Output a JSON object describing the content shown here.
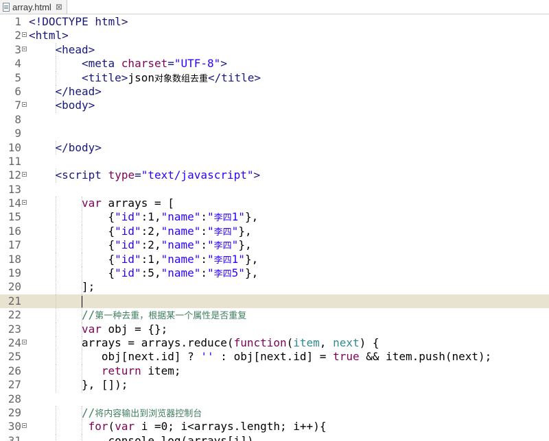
{
  "tab": {
    "title": "array.html",
    "close_glyph": "⊠"
  },
  "editor": {
    "current_line": 21,
    "lines": [
      {
        "n": "1",
        "fold": false,
        "indent": 0,
        "segs": [
          {
            "c": "tg",
            "t": "<!DOCTYPE html>"
          }
        ]
      },
      {
        "n": "2",
        "fold": true,
        "indent": 0,
        "segs": [
          {
            "c": "tg",
            "t": "<html>"
          }
        ]
      },
      {
        "n": "3",
        "fold": true,
        "indent": 1,
        "segs": [
          {
            "c": "tg",
            "t": "<head>"
          }
        ]
      },
      {
        "n": "4",
        "fold": false,
        "indent": 2,
        "segs": [
          {
            "c": "tg",
            "t": "<meta "
          },
          {
            "c": "at",
            "t": "charset"
          },
          {
            "c": "tg",
            "t": "="
          },
          {
            "c": "st",
            "t": "\"UTF-8\""
          },
          {
            "c": "tg",
            "t": ">"
          }
        ]
      },
      {
        "n": "5",
        "fold": false,
        "indent": 2,
        "segs": [
          {
            "c": "tg",
            "t": "<title>"
          },
          {
            "c": "nm",
            "t": "json"
          },
          {
            "c": "nm cjk",
            "t": "对象数组去重"
          },
          {
            "c": "tg",
            "t": "</title>"
          }
        ]
      },
      {
        "n": "6",
        "fold": false,
        "indent": 1,
        "segs": [
          {
            "c": "tg",
            "t": "</head>"
          }
        ]
      },
      {
        "n": "7",
        "fold": true,
        "indent": 1,
        "segs": [
          {
            "c": "tg",
            "t": "<body>"
          }
        ]
      },
      {
        "n": "8",
        "fold": false,
        "indent": 0,
        "segs": []
      },
      {
        "n": "9",
        "fold": false,
        "indent": 0,
        "segs": []
      },
      {
        "n": "10",
        "fold": false,
        "indent": 1,
        "segs": [
          {
            "c": "tg",
            "t": "</body>"
          }
        ]
      },
      {
        "n": "11",
        "fold": false,
        "indent": 0,
        "segs": []
      },
      {
        "n": "12",
        "fold": true,
        "indent": 1,
        "segs": [
          {
            "c": "tg",
            "t": "<script "
          },
          {
            "c": "at",
            "t": "type"
          },
          {
            "c": "tg",
            "t": "="
          },
          {
            "c": "st",
            "t": "\"text/javascript\""
          },
          {
            "c": "tg",
            "t": ">"
          }
        ]
      },
      {
        "n": "13",
        "fold": false,
        "indent": 0,
        "segs": []
      },
      {
        "n": "14",
        "fold": true,
        "indent": 2,
        "segs": [
          {
            "c": "kw",
            "t": "var "
          },
          {
            "c": "js",
            "t": "arrays = ["
          }
        ]
      },
      {
        "n": "15",
        "fold": false,
        "indent": 3,
        "segs": [
          {
            "c": "js",
            "t": "{"
          },
          {
            "c": "jsstr",
            "t": "\"id\""
          },
          {
            "c": "js",
            "t": ":1,"
          },
          {
            "c": "jsstr",
            "t": "\"name\""
          },
          {
            "c": "js",
            "t": ":"
          },
          {
            "c": "jsstr",
            "t": "\""
          },
          {
            "c": "jsstr cjk",
            "t": "李四"
          },
          {
            "c": "jsstr",
            "t": "1\""
          },
          {
            "c": "js",
            "t": "},"
          }
        ]
      },
      {
        "n": "16",
        "fold": false,
        "indent": 3,
        "segs": [
          {
            "c": "js",
            "t": "{"
          },
          {
            "c": "jsstr",
            "t": "\"id\""
          },
          {
            "c": "js",
            "t": ":2,"
          },
          {
            "c": "jsstr",
            "t": "\"name\""
          },
          {
            "c": "js",
            "t": ":"
          },
          {
            "c": "jsstr",
            "t": "\""
          },
          {
            "c": "jsstr cjk",
            "t": "李四"
          },
          {
            "c": "jsstr",
            "t": "\""
          },
          {
            "c": "js",
            "t": "},"
          }
        ]
      },
      {
        "n": "17",
        "fold": false,
        "indent": 3,
        "segs": [
          {
            "c": "js",
            "t": "{"
          },
          {
            "c": "jsstr",
            "t": "\"id\""
          },
          {
            "c": "js",
            "t": ":2,"
          },
          {
            "c": "jsstr",
            "t": "\"name\""
          },
          {
            "c": "js",
            "t": ":"
          },
          {
            "c": "jsstr",
            "t": "\""
          },
          {
            "c": "jsstr cjk",
            "t": "李四"
          },
          {
            "c": "jsstr",
            "t": "\""
          },
          {
            "c": "js",
            "t": "},"
          }
        ]
      },
      {
        "n": "18",
        "fold": false,
        "indent": 3,
        "segs": [
          {
            "c": "js",
            "t": "{"
          },
          {
            "c": "jsstr",
            "t": "\"id\""
          },
          {
            "c": "js",
            "t": ":1,"
          },
          {
            "c": "jsstr",
            "t": "\"name\""
          },
          {
            "c": "js",
            "t": ":"
          },
          {
            "c": "jsstr",
            "t": "\""
          },
          {
            "c": "jsstr cjk",
            "t": "李四"
          },
          {
            "c": "jsstr",
            "t": "1\""
          },
          {
            "c": "js",
            "t": "},"
          }
        ]
      },
      {
        "n": "19",
        "fold": false,
        "indent": 3,
        "segs": [
          {
            "c": "js",
            "t": "{"
          },
          {
            "c": "jsstr",
            "t": "\"id\""
          },
          {
            "c": "js",
            "t": ":5,"
          },
          {
            "c": "jsstr",
            "t": "\"name\""
          },
          {
            "c": "js",
            "t": ":"
          },
          {
            "c": "jsstr",
            "t": "\""
          },
          {
            "c": "jsstr cjk",
            "t": "李四"
          },
          {
            "c": "jsstr",
            "t": "5\""
          },
          {
            "c": "js",
            "t": "},"
          }
        ]
      },
      {
        "n": "20",
        "fold": false,
        "indent": 2,
        "segs": [
          {
            "c": "js",
            "t": "];"
          }
        ]
      },
      {
        "n": "21",
        "fold": false,
        "indent": 2,
        "segs": []
      },
      {
        "n": "22",
        "fold": false,
        "indent": 2,
        "segs": [
          {
            "c": "cm",
            "t": "//"
          },
          {
            "c": "cm cjk",
            "t": "第一种去重，根据某一个属性是否重复"
          }
        ]
      },
      {
        "n": "23",
        "fold": false,
        "indent": 2,
        "segs": [
          {
            "c": "kw",
            "t": "var "
          },
          {
            "c": "js",
            "t": "obj = {};"
          }
        ]
      },
      {
        "n": "24",
        "fold": true,
        "indent": 2,
        "segs": [
          {
            "c": "js",
            "t": "arrays = arrays.reduce("
          },
          {
            "c": "kw",
            "t": "function"
          },
          {
            "c": "js",
            "t": "("
          },
          {
            "c": "prop",
            "t": "item"
          },
          {
            "c": "js",
            "t": ", "
          },
          {
            "c": "prop",
            "t": "next"
          },
          {
            "c": "js",
            "t": ") {"
          }
        ]
      },
      {
        "n": "25",
        "fold": false,
        "indent": 2,
        "pad": "   ",
        "segs": [
          {
            "c": "js",
            "t": "obj[next.id] ? "
          },
          {
            "c": "jsstr",
            "t": "''"
          },
          {
            "c": "js",
            "t": " : obj[next.id] = "
          },
          {
            "c": "bool",
            "t": "true"
          },
          {
            "c": "js",
            "t": " && item.push(next);"
          }
        ]
      },
      {
        "n": "26",
        "fold": false,
        "indent": 2,
        "pad": "   ",
        "segs": [
          {
            "c": "kw",
            "t": "return "
          },
          {
            "c": "js",
            "t": "item;"
          }
        ]
      },
      {
        "n": "27",
        "fold": false,
        "indent": 2,
        "segs": [
          {
            "c": "js",
            "t": "}, []);"
          }
        ]
      },
      {
        "n": "28",
        "fold": false,
        "indent": 0,
        "segs": []
      },
      {
        "n": "29",
        "fold": false,
        "indent": 2,
        "segs": [
          {
            "c": "cm",
            "t": "//"
          },
          {
            "c": "cm cjk",
            "t": "将内容输出到浏览器控制台"
          }
        ]
      },
      {
        "n": "30",
        "fold": true,
        "indent": 2,
        "pad": " ",
        "segs": [
          {
            "c": "kw",
            "t": "for"
          },
          {
            "c": "js",
            "t": "("
          },
          {
            "c": "kw",
            "t": "var "
          },
          {
            "c": "js",
            "t": "i ="
          },
          {
            "c": "jsnum",
            "t": "0"
          },
          {
            "c": "js",
            "t": "; i<arrays.length; i++){"
          }
        ]
      },
      {
        "n": "31",
        "fold": false,
        "indent": 2,
        "pad": "    ",
        "segs": [
          {
            "c": "js",
            "t": "console.log(arrays[i])"
          }
        ]
      }
    ]
  }
}
